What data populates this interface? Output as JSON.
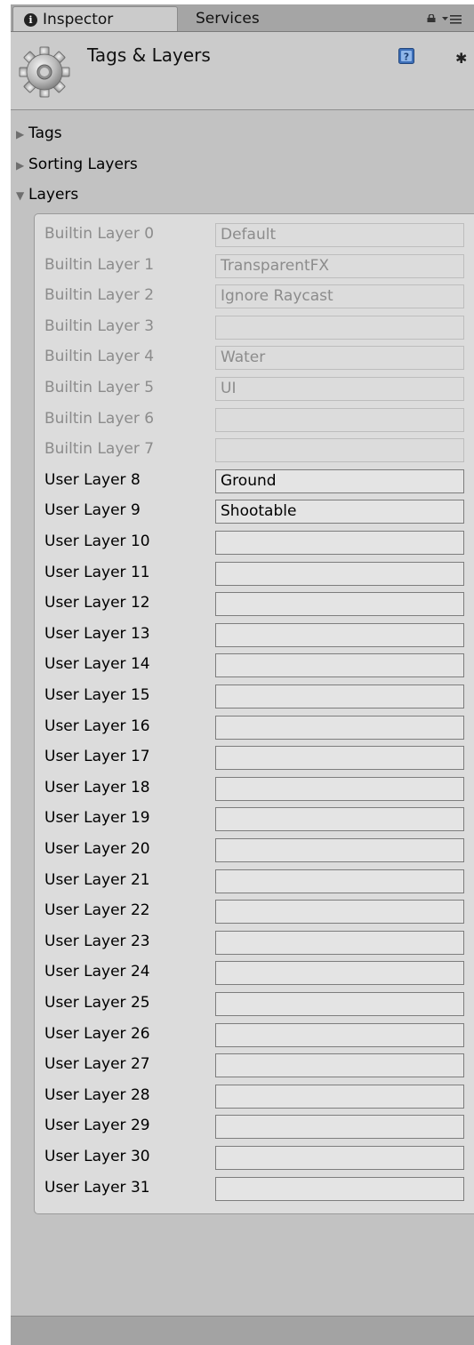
{
  "tabs": {
    "inspector_label": "Inspector",
    "services_label": "Services"
  },
  "header": {
    "title": "Tags & Layers"
  },
  "foldouts": {
    "tags": "Tags",
    "sorting_layers": "Sorting Layers",
    "layers": "Layers"
  },
  "layers": [
    {
      "label": "Builtin Layer 0",
      "value": "Default",
      "builtin": true
    },
    {
      "label": "Builtin Layer 1",
      "value": "TransparentFX",
      "builtin": true
    },
    {
      "label": "Builtin Layer 2",
      "value": "Ignore Raycast",
      "builtin": true
    },
    {
      "label": "Builtin Layer 3",
      "value": "",
      "builtin": true
    },
    {
      "label": "Builtin Layer 4",
      "value": "Water",
      "builtin": true
    },
    {
      "label": "Builtin Layer 5",
      "value": "UI",
      "builtin": true
    },
    {
      "label": "Builtin Layer 6",
      "value": "",
      "builtin": true
    },
    {
      "label": "Builtin Layer 7",
      "value": "",
      "builtin": true
    },
    {
      "label": "User Layer 8",
      "value": "Ground",
      "builtin": false
    },
    {
      "label": "User Layer 9",
      "value": "Shootable",
      "builtin": false
    },
    {
      "label": "User Layer 10",
      "value": "",
      "builtin": false
    },
    {
      "label": "User Layer 11",
      "value": "",
      "builtin": false
    },
    {
      "label": "User Layer 12",
      "value": "",
      "builtin": false
    },
    {
      "label": "User Layer 13",
      "value": "",
      "builtin": false
    },
    {
      "label": "User Layer 14",
      "value": "",
      "builtin": false
    },
    {
      "label": "User Layer 15",
      "value": "",
      "builtin": false
    },
    {
      "label": "User Layer 16",
      "value": "",
      "builtin": false
    },
    {
      "label": "User Layer 17",
      "value": "",
      "builtin": false
    },
    {
      "label": "User Layer 18",
      "value": "",
      "builtin": false
    },
    {
      "label": "User Layer 19",
      "value": "",
      "builtin": false
    },
    {
      "label": "User Layer 20",
      "value": "",
      "builtin": false
    },
    {
      "label": "User Layer 21",
      "value": "",
      "builtin": false
    },
    {
      "label": "User Layer 22",
      "value": "",
      "builtin": false
    },
    {
      "label": "User Layer 23",
      "value": "",
      "builtin": false
    },
    {
      "label": "User Layer 24",
      "value": "",
      "builtin": false
    },
    {
      "label": "User Layer 25",
      "value": "",
      "builtin": false
    },
    {
      "label": "User Layer 26",
      "value": "",
      "builtin": false
    },
    {
      "label": "User Layer 27",
      "value": "",
      "builtin": false
    },
    {
      "label": "User Layer 28",
      "value": "",
      "builtin": false
    },
    {
      "label": "User Layer 29",
      "value": "",
      "builtin": false
    },
    {
      "label": "User Layer 30",
      "value": "",
      "builtin": false
    },
    {
      "label": "User Layer 31",
      "value": "",
      "builtin": false
    }
  ],
  "icons": {
    "info": "info-icon",
    "lock": "lock-icon",
    "menu": "tab-menu-icon",
    "gear": "gear-icon",
    "help": "help-icon",
    "settings": "settings-icon",
    "foldout_collapsed": "triangle-right-icon",
    "foldout_expanded": "triangle-down-icon"
  }
}
